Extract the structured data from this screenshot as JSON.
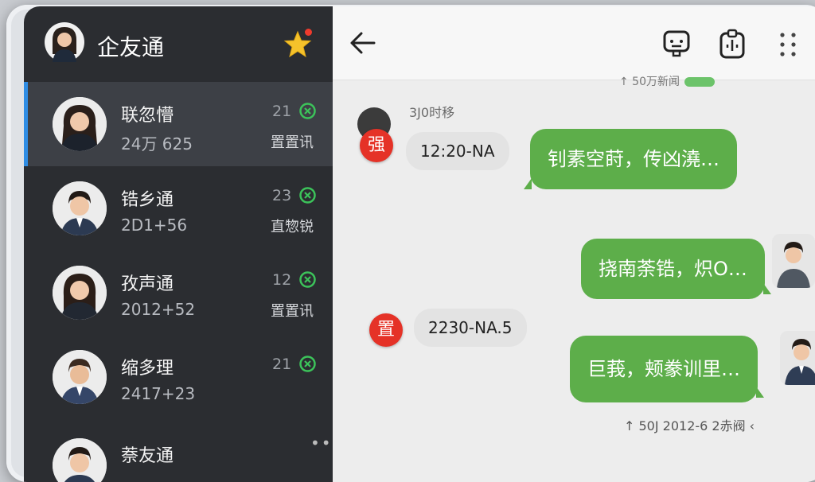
{
  "app": {
    "title": "企友通"
  },
  "sidebar": {
    "chats": [
      {
        "name": "联忽懵",
        "sub": "24万 625",
        "num": "21",
        "tag": "置置讯",
        "active": true
      },
      {
        "name": "锆乡通",
        "sub": "2D1+56",
        "num": "23",
        "tag": "直惣锐",
        "active": false
      },
      {
        "name": "孜声通",
        "sub": "2012+52",
        "num": "12",
        "tag": "置置讯",
        "active": false
      },
      {
        "name": "缩多理",
        "sub": "2417+23",
        "num": "21",
        "tag": "",
        "active": false
      },
      {
        "name": "萘友通",
        "sub": "",
        "num": "",
        "tag": "",
        "more": "•••",
        "active": false
      }
    ]
  },
  "chat": {
    "top_strip": "↑ 50万新闻",
    "time_label": "3J0时移",
    "messages": [
      {
        "side": "left",
        "badge": "强",
        "text": "12:20-NA"
      },
      {
        "side": "right",
        "text": "钊素空莳，传凶澆…"
      },
      {
        "side": "right",
        "text": "挠南荼锆，炽O…"
      },
      {
        "side": "left",
        "badge": "置",
        "text": "2230-NA.5"
      },
      {
        "side": "right",
        "text": "巨莪，颊豢训里…"
      }
    ],
    "footer": "↑ 50J 2012-6 2赤阀 ‹"
  },
  "colors": {
    "sidebar_bg": "#2b2d31",
    "bubble_green": "#5dae4a",
    "badge_red": "#e53227",
    "check_green": "#3cc35a",
    "active_bar": "#2f8de4"
  }
}
